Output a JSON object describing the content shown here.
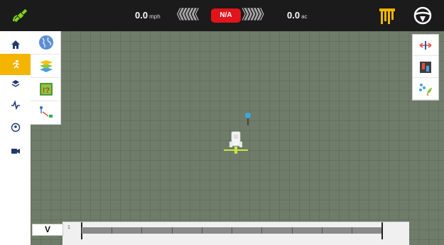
{
  "topbar": {
    "speed_value": "0.0",
    "speed_unit": "mph",
    "chevrons_left": "《《《《《《",
    "status_badge": "N/A",
    "chevrons_right": "》》》》》》",
    "area_value": "0.0",
    "area_unit": "ac",
    "icons": [
      "gps-satellite-icon",
      "boom-sections-icon",
      "steering-wheel-icon"
    ],
    "colors": {
      "background": "#1b1b1b",
      "gps_green": "#7fd321",
      "badge_red": "#e3131b",
      "section_gold": "#f1b400"
    }
  },
  "sidebar": {
    "items": [
      {
        "icon": "home-icon"
      },
      {
        "icon": "run-screen-icon",
        "active": true
      },
      {
        "icon": "field-layers-icon"
      },
      {
        "icon": "diagnostics-pulse-icon"
      },
      {
        "icon": "gps-status-icon"
      },
      {
        "icon": "camera-icon"
      }
    ],
    "active_color": "#f5b400"
  },
  "map_tools": {
    "items": [
      {
        "icon": "world-globe-icon"
      },
      {
        "icon": "layers-icon"
      },
      {
        "icon": "field-boundary-icon"
      },
      {
        "icon": "flag-mark-icon"
      }
    ]
  },
  "right_tools": {
    "items": [
      {
        "icon": "swath-width-icon"
      },
      {
        "icon": "implement-status-icon"
      },
      {
        "icon": "product-application-icon"
      }
    ]
  },
  "map": {
    "background_color": "#6f7c6a",
    "marker_icon": "location-pin-icon",
    "vehicle_icon": "tractor-icon"
  },
  "bottom": {
    "view_button": "V",
    "lightbar_label": "1"
  }
}
